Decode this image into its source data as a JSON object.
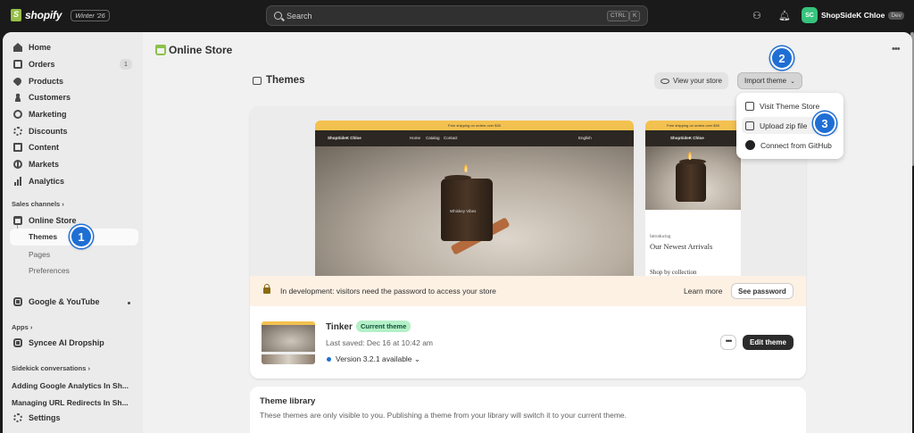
{
  "topbar": {
    "brand": "shopify",
    "edition": "Winter '26",
    "search_placeholder": "Search",
    "kbd_ctrl": "CTRL",
    "kbd_k": "K",
    "account_initials": "SC",
    "account_name": "ShopSideK Chloe",
    "account_badge": "Dev"
  },
  "sidebar": {
    "items": [
      {
        "label": "Home",
        "icon": "home-icon"
      },
      {
        "label": "Orders",
        "icon": "orders-icon",
        "count": "1"
      },
      {
        "label": "Products",
        "icon": "tag-icon"
      },
      {
        "label": "Customers",
        "icon": "person-icon"
      },
      {
        "label": "Marketing",
        "icon": "target-icon"
      },
      {
        "label": "Discounts",
        "icon": "discount-icon"
      },
      {
        "label": "Content",
        "icon": "document-icon"
      },
      {
        "label": "Markets",
        "icon": "globe-icon"
      },
      {
        "label": "Analytics",
        "icon": "chart-icon"
      }
    ],
    "sales_channels_heading": "Sales channels",
    "online_store": "Online Store",
    "online_store_sub": [
      "Themes",
      "Pages",
      "Preferences"
    ],
    "google_youtube": "Google & YouTube",
    "apps_heading": "Apps",
    "app_item": "Syncee AI Dropship",
    "sidekick_heading": "Sidekick conversations",
    "conversations": [
      "Adding Google Analytics In Sh...",
      "Managing URL Redirects In Sh..."
    ],
    "settings": "Settings"
  },
  "main": {
    "page_title": "Online Store",
    "section_title": "Themes",
    "view_store_label": "View your store",
    "import_theme_label": "Import theme",
    "import_menu": [
      "Visit Theme Store",
      "Upload zip file",
      "Connect from GitHub"
    ],
    "preview": {
      "announcement": "Free shipping on orders over $30",
      "site_name": "ShopSideK Chloe",
      "nav_links": [
        "Home",
        "Catalog",
        "Contact"
      ],
      "locale": "English",
      "jar_label": "Whiskey Vibes",
      "mobile_kicker": "Introducing",
      "mobile_heading": "Our Newest Arrivals",
      "mobile_collection": "Shop by collection"
    },
    "dev_banner": {
      "text": "In development: visitors need the password to access your store",
      "learn_more": "Learn more",
      "see_password": "See password"
    },
    "current_theme": {
      "name": "Tinker",
      "badge": "Current theme",
      "saved": "Last saved: Dec 16 at 10:42 am",
      "version": "Version 3.2.1 available",
      "more": "•••",
      "edit_label": "Edit theme"
    },
    "library": {
      "title": "Theme library",
      "description": "These themes are only visible to you. Publishing a theme from your library will switch it to your current theme."
    },
    "steps": [
      "1",
      "2",
      "3"
    ]
  },
  "colors": {
    "accent_blue": "#1f6ed4",
    "brand_green": "#95bf47",
    "badge_green": "#b4f0c8"
  }
}
